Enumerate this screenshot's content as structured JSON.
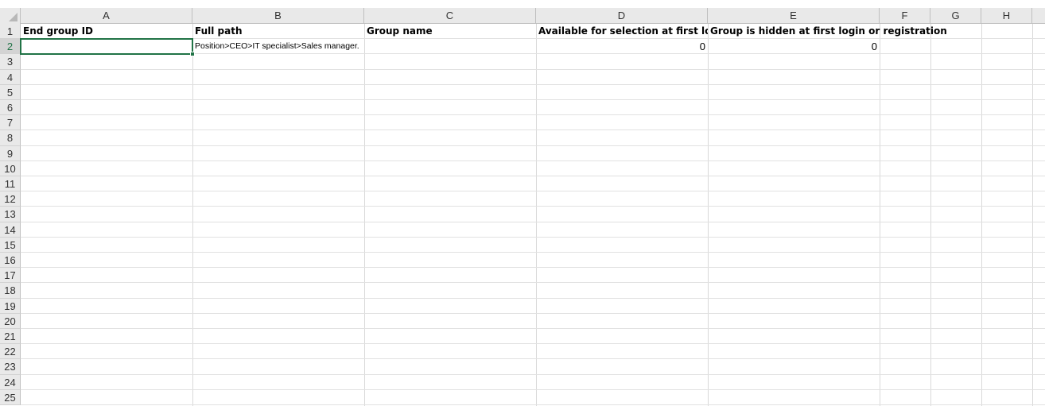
{
  "columns": [
    "A",
    "B",
    "C",
    "D",
    "E",
    "F",
    "G",
    "H"
  ],
  "rows": [
    "1",
    "2",
    "3",
    "4",
    "5",
    "6",
    "7",
    "8",
    "9",
    "10",
    "11",
    "12",
    "13",
    "14",
    "15",
    "16",
    "17",
    "18",
    "19",
    "20",
    "21",
    "22",
    "23",
    "24",
    "25"
  ],
  "row1": {
    "a1": "End group ID",
    "b1": "Full path",
    "c1": "Group name",
    "d1": "Available for selection at first login o",
    "e1": "Group is hidden at first login or registration"
  },
  "row2": {
    "a2": "",
    "b2": "Position>CEO>IT specialist>Sales manager.",
    "c2": "",
    "d2": "0",
    "e2": "0"
  },
  "selection": {
    "cell": "A2"
  },
  "colors": {
    "accent": "#217346",
    "header_bg": "#e9e9e9",
    "grid": "#d9d9d9"
  }
}
